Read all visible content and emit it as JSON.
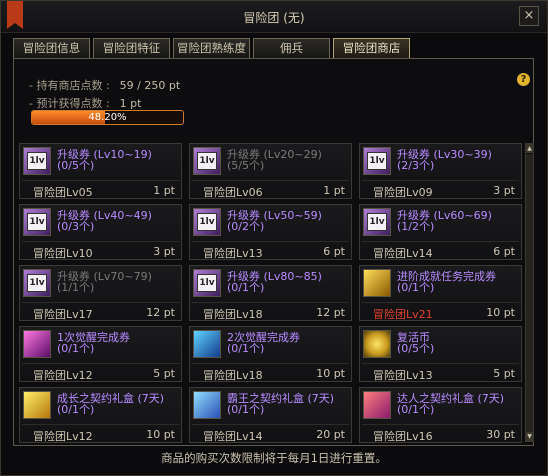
{
  "window": {
    "title": "冒险团 (无)"
  },
  "tabs": [
    {
      "label": "冒险团信息"
    },
    {
      "label": "冒险团特征"
    },
    {
      "label": "冒险团熟练度"
    },
    {
      "label": "佣兵"
    },
    {
      "label": "冒险团商店"
    }
  ],
  "info": {
    "points_label": "- 持有商店点数 :",
    "points_value": "59 / 250 pt",
    "expected_label": "- 预计获得点数 :",
    "expected_value": "1 pt",
    "progress_text": "48.20%",
    "progress_fraction": 0.482,
    "help_glyph": "?"
  },
  "items": [
    {
      "name": "升级券 (Lv10~19)",
      "count": "(0/5个)",
      "level": "冒险团Lv05",
      "price": "1 pt",
      "icon": "level-up-ticket-icon",
      "name_color": "#b98cff",
      "count_color": "#b98cff",
      "level_color": "#cfc7b3"
    },
    {
      "name": "升级券 (Lv20~29)",
      "count": "(5/5个)",
      "level": "冒险团Lv06",
      "price": "1 pt",
      "icon": "level-up-ticket-icon",
      "name_color": "#7a7a7a",
      "count_color": "#7a7a7a",
      "level_color": "#cfc7b3"
    },
    {
      "name": "升级券 (Lv30~39)",
      "count": "(2/3个)",
      "level": "冒险团Lv09",
      "price": "3 pt",
      "icon": "level-up-ticket-icon",
      "name_color": "#b98cff",
      "count_color": "#b98cff",
      "level_color": "#cfc7b3"
    },
    {
      "name": "升级券 (Lv40~49)",
      "count": "(0/3个)",
      "level": "冒险团Lv10",
      "price": "3 pt",
      "icon": "level-up-ticket-icon",
      "name_color": "#b98cff",
      "count_color": "#b98cff",
      "level_color": "#cfc7b3"
    },
    {
      "name": "升级券 (Lv50~59)",
      "count": "(0/2个)",
      "level": "冒险团Lv13",
      "price": "6 pt",
      "icon": "level-up-ticket-icon",
      "name_color": "#b98cff",
      "count_color": "#b98cff",
      "level_color": "#cfc7b3"
    },
    {
      "name": "升级券 (Lv60~69)",
      "count": "(1/2个)",
      "level": "冒险团Lv14",
      "price": "6 pt",
      "icon": "level-up-ticket-icon",
      "name_color": "#b98cff",
      "count_color": "#b98cff",
      "level_color": "#cfc7b3"
    },
    {
      "name": "升级券 (Lv70~79)",
      "count": "(1/1个)",
      "level": "冒险团Lv17",
      "price": "12 pt",
      "icon": "level-up-ticket-icon",
      "name_color": "#7a7a7a",
      "count_color": "#7a7a7a",
      "level_color": "#cfc7b3"
    },
    {
      "name": "升级券 (Lv80~85)",
      "count": "(0/1个)",
      "level": "冒险团Lv18",
      "price": "12 pt",
      "icon": "level-up-ticket-icon",
      "name_color": "#b98cff",
      "count_color": "#b98cff",
      "level_color": "#cfc7b3"
    },
    {
      "name": "进阶成就任务完成券",
      "count": "(0/1个)",
      "level": "冒险团Lv21",
      "price": "10 pt",
      "icon": "quest-ticket-icon",
      "name_color": "#b98cff",
      "count_color": "#b98cff",
      "level_color": "#e0412f"
    },
    {
      "name": "1次觉醒完成券",
      "count": "(0/1个)",
      "level": "冒险团Lv12",
      "price": "5 pt",
      "icon": "awakening-ticket-1-icon",
      "name_color": "#b98cff",
      "count_color": "#b98cff",
      "level_color": "#cfc7b3"
    },
    {
      "name": "2次觉醒完成券",
      "count": "(0/1个)",
      "level": "冒险团Lv18",
      "price": "10 pt",
      "icon": "awakening-ticket-2-icon",
      "name_color": "#b98cff",
      "count_color": "#b98cff",
      "level_color": "#cfc7b3"
    },
    {
      "name": "复活币",
      "count": "(0/5个)",
      "level": "冒险团Lv13",
      "price": "5 pt",
      "icon": "revive-coin-icon",
      "name_color": "#b98cff",
      "count_color": "#b98cff",
      "level_color": "#cfc7b3"
    },
    {
      "name": "成长之契约礼盒 (7天)",
      "count": "(0/1个)",
      "level": "冒险团Lv12",
      "price": "10 pt",
      "icon": "growth-contract-box-icon",
      "name_color": "#b98cff",
      "count_color": "#b98cff",
      "level_color": "#cfc7b3"
    },
    {
      "name": "霸王之契约礼盒 (7天)",
      "count": "(0/1个)",
      "level": "冒险团Lv14",
      "price": "20 pt",
      "icon": "overlord-contract-box-icon",
      "name_color": "#b98cff",
      "count_color": "#b98cff",
      "level_color": "#cfc7b3"
    },
    {
      "name": "达人之契约礼盒 (7天)",
      "count": "(0/1个)",
      "level": "冒险团Lv16",
      "price": "30 pt",
      "icon": "master-contract-box-icon",
      "name_color": "#b98cff",
      "count_color": "#b98cff",
      "level_color": "#cfc7b3"
    }
  ],
  "footer": {
    "notice": "商品的购买次数限制将于每月1日进行重置。"
  },
  "close_glyph": "×"
}
